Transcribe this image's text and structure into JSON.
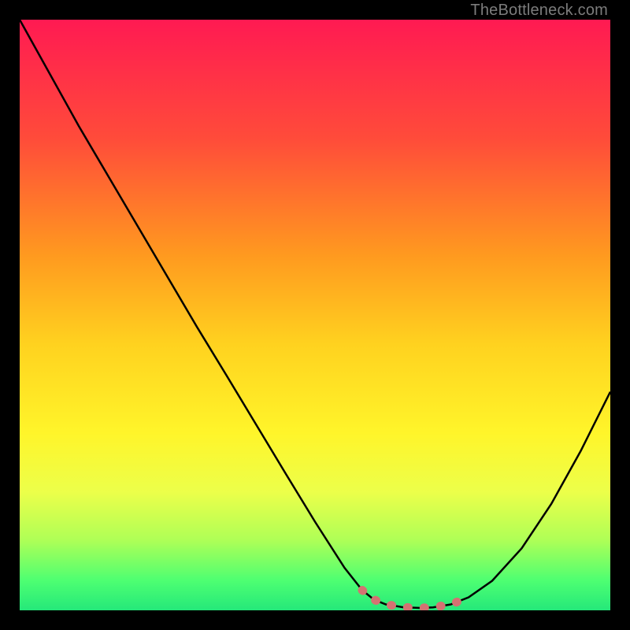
{
  "watermark": "TheBottleneck.com",
  "chart_data": {
    "type": "line",
    "title": "",
    "xlabel": "",
    "ylabel": "",
    "xlim": [
      0,
      100
    ],
    "ylim": [
      0,
      100
    ],
    "grid": false,
    "legend": false,
    "series": [
      {
        "name": "bottleneck-curve",
        "x": [
          0,
          5,
          10,
          15,
          20,
          25,
          30,
          35,
          40,
          45,
          50,
          55,
          58,
          60,
          62,
          65,
          68,
          70,
          73,
          76,
          80,
          85,
          90,
          95,
          100
        ],
        "y": [
          100,
          91,
          82,
          73.5,
          65,
          56.5,
          48,
          39.8,
          31.5,
          23.2,
          15,
          7.2,
          3.4,
          1.8,
          1.0,
          0.5,
          0.4,
          0.5,
          1.0,
          2.2,
          5.0,
          10.5,
          18.0,
          27.0,
          37.0
        ],
        "color": "#000000"
      },
      {
        "name": "highlight-segment",
        "x": [
          58,
          60,
          62,
          65,
          68,
          70,
          73,
          76
        ],
        "y": [
          3.4,
          1.8,
          1.0,
          0.5,
          0.4,
          0.5,
          1.0,
          2.2
        ],
        "color": "#d47272",
        "thick": true,
        "dotted": true
      }
    ],
    "gradient_stops": [
      {
        "offset": 0,
        "color": "#ff1a52"
      },
      {
        "offset": 20,
        "color": "#ff4b3a"
      },
      {
        "offset": 40,
        "color": "#ff9a1f"
      },
      {
        "offset": 55,
        "color": "#ffd21f"
      },
      {
        "offset": 70,
        "color": "#fff52a"
      },
      {
        "offset": 80,
        "color": "#ecff4a"
      },
      {
        "offset": 88,
        "color": "#b0ff56"
      },
      {
        "offset": 95,
        "color": "#4dff72"
      },
      {
        "offset": 100,
        "color": "#25e87a"
      }
    ]
  }
}
